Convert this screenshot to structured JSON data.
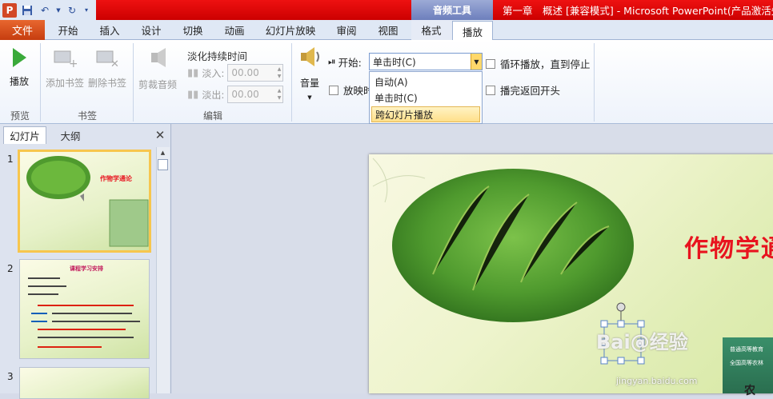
{
  "titlebar": {
    "context_title": "音频工具",
    "window_title": "第一章　概述 [兼容模式] - Microsoft PowerPoint(产品激活失"
  },
  "tabs": {
    "file": "文件",
    "home": "开始",
    "insert": "插入",
    "design": "设计",
    "transitions": "切换",
    "animations": "动画",
    "slideshow": "幻灯片放映",
    "review": "审阅",
    "view": "视图",
    "format": "格式",
    "playback": "播放"
  },
  "ribbon": {
    "preview": {
      "play_label": "播放",
      "group": "预览"
    },
    "bookmarks": {
      "add_label": "添加书签",
      "remove_label": "删除书签",
      "group": "书签"
    },
    "editing": {
      "trim_label": "剪裁音频",
      "fade_title": "淡化持续时间",
      "fade_in_label": "淡入:",
      "fade_out_label": "淡出:",
      "fade_in_value": "00.00",
      "fade_out_value": "00.00",
      "group": "编辑"
    },
    "audio_options": {
      "volume_label": "音量",
      "start_label": "开始:",
      "start_value": "单击时(C)",
      "options": [
        "自动(A)",
        "单击时(C)",
        "跨幻灯片播放"
      ],
      "hide_label_partial": "放映时",
      "loop_label": "循环播放，直到停止",
      "rewind_label": "播完返回开头"
    }
  },
  "panel": {
    "tab_slides": "幻灯片",
    "tab_outline": "大纲",
    "slide_numbers": [
      "1",
      "2",
      "3"
    ]
  },
  "thumbs": {
    "t1_title": "作物学通论",
    "t2_title": "课程学习安排"
  },
  "slide": {
    "title": "作物学通",
    "bottom_text": "农",
    "book_lines": [
      "普通高等教育",
      "全国高等农林"
    ]
  },
  "watermark": {
    "text": "Bai@经验",
    "url": "jingyan.baidu.com"
  }
}
